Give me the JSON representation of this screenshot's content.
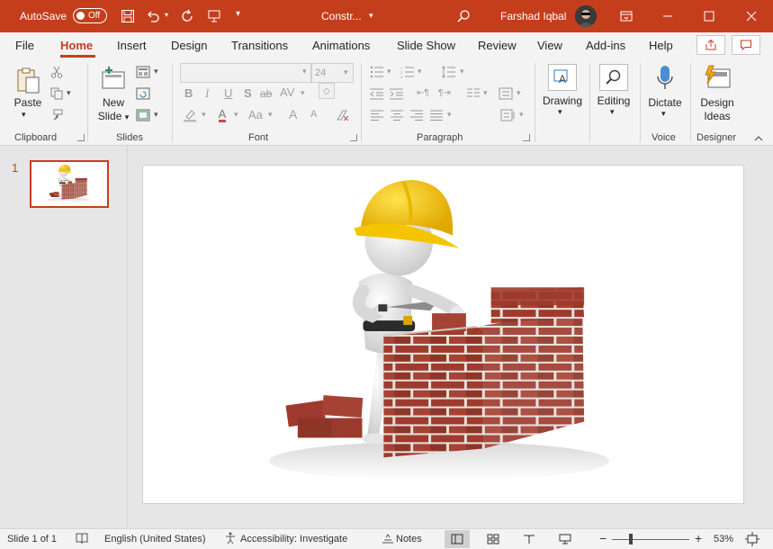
{
  "titlebar": {
    "autosave_label": "AutoSave",
    "autosave_state": "Off",
    "doc_title": "Constr...",
    "user_name": "Farshad Iqbal"
  },
  "tabs": [
    "File",
    "Home",
    "Insert",
    "Design",
    "Transitions",
    "Animations",
    "Slide Show",
    "Review",
    "View",
    "Add-ins",
    "Help"
  ],
  "active_tab": "Home",
  "ribbon": {
    "paste_label": "Paste",
    "new_slide_label_1": "New",
    "new_slide_label_2": "Slide",
    "font_size": "24",
    "drawing_label": "Drawing",
    "editing_label": "Editing",
    "dictate_label": "Dictate",
    "design_ideas_1": "Design",
    "design_ideas_2": "Ideas",
    "groups": {
      "clipboard": "Clipboard",
      "slides": "Slides",
      "font": "Font",
      "paragraph": "Paragraph",
      "voice": "Voice",
      "designer": "Designer"
    },
    "font_buttons": [
      "B",
      "I",
      "U",
      "S",
      "ab",
      "AV",
      "A",
      "Aa",
      "A",
      "A"
    ]
  },
  "thumbnails": [
    {
      "number": "1"
    }
  ],
  "statusbar": {
    "slide_info": "Slide 1 of 1",
    "language": "English (United States)",
    "accessibility": "Accessibility: Investigate",
    "notes": "Notes",
    "zoom_minus": "−",
    "zoom_plus": "+",
    "zoom_percent": "53%",
    "zoom_level": 0.53
  },
  "colors": {
    "accent": "#c43e1c",
    "ribbon_bg": "#f3f3f3",
    "workspace_bg": "#e6e6e6",
    "helmet": "#f5c400",
    "brick": "#9e3b2e"
  },
  "icons": [
    "save-icon",
    "undo-icon",
    "redo-icon",
    "presenter-icon",
    "customize-qat-icon",
    "search-icon",
    "ribbon-display-icon",
    "minimize-icon",
    "maximize-icon",
    "close-icon",
    "share-icon",
    "comments-icon",
    "cut-icon",
    "copy-icon",
    "format-painter-icon",
    "layout-icon",
    "reset-icon",
    "section-icon",
    "clear-formatting-icon",
    "bullets-icon",
    "numbering-icon",
    "line-spacing-icon",
    "align-left-icon",
    "align-center-icon",
    "align-right-icon",
    "justify-icon",
    "text-direction-icon",
    "microphone-icon",
    "design-ideas-icon",
    "collapse-ribbon-icon",
    "notes-icon",
    "normal-view-icon",
    "slide-sorter-icon",
    "reading-view-icon",
    "slideshow-icon",
    "fit-slide-icon",
    "spellcheck-icon",
    "accessibility-icon"
  ]
}
